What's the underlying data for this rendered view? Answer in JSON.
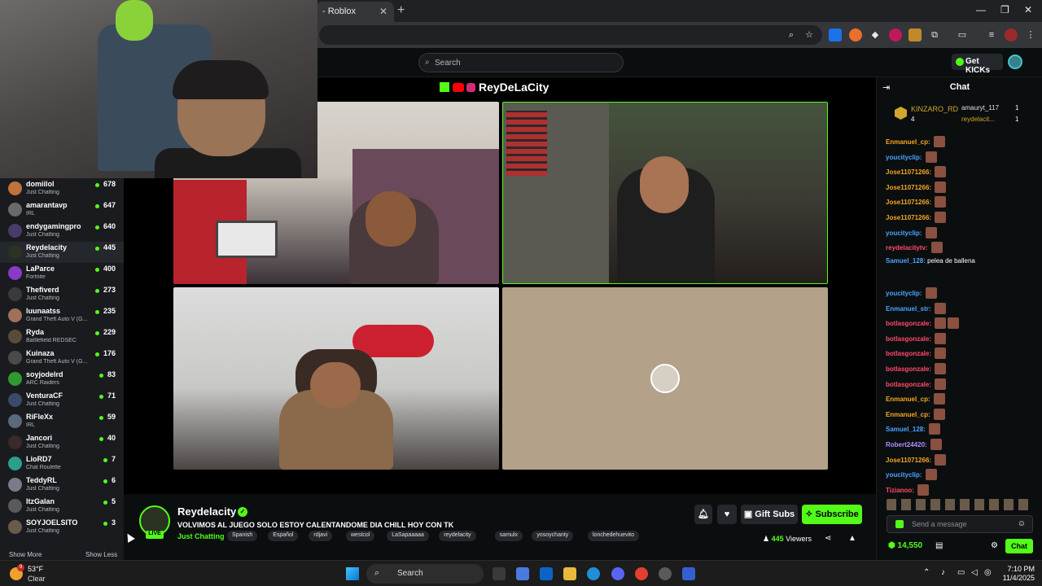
{
  "browser": {
    "tab_title": "- Roblox",
    "tab_close": "✕",
    "new_tab": "+",
    "min": "—",
    "max": "❐",
    "close": "✕"
  },
  "kick": {
    "search_placeholder": "Search",
    "get_kicks": "Get KICKs"
  },
  "sidebar": {
    "channels": [
      {
        "name": "domiilol",
        "category": "Just Chatting",
        "viewers": "678",
        "color": "#c0733a"
      },
      {
        "name": "amarantavp",
        "category": "IRL",
        "viewers": "647",
        "color": "#6a6a6a"
      },
      {
        "name": "endygamingpro",
        "category": "Just Chatting",
        "viewers": "640",
        "color": "#4a3b6a"
      },
      {
        "name": "Reydelacity",
        "category": "Just Chatting",
        "viewers": "445",
        "color": "#2a3322"
      },
      {
        "name": "LaParce",
        "category": "Fortnite",
        "viewers": "400",
        "color": "#8a3ac8"
      },
      {
        "name": "Thefiverd",
        "category": "Just Chatting",
        "viewers": "273",
        "color": "#3a3a3a"
      },
      {
        "name": "luunaatss",
        "category": "Grand Theft Auto V (G...",
        "viewers": "235",
        "color": "#a0705a"
      },
      {
        "name": "Ryda",
        "category": "Battlefield REDSEC",
        "viewers": "229",
        "color": "#5a4a3a"
      },
      {
        "name": "Kuinaza",
        "category": "Grand Theft Auto V (G...",
        "viewers": "176",
        "color": "#4a4a4a"
      },
      {
        "name": "soyjodelrd",
        "category": "ARC Raiders",
        "viewers": "83",
        "color": "#2f9a2f"
      },
      {
        "name": "VenturaCF",
        "category": "Just Chatting",
        "viewers": "71",
        "color": "#3a4a6a"
      },
      {
        "name": "RiFleXx",
        "category": "IRL",
        "viewers": "59",
        "color": "#5a6a7a"
      },
      {
        "name": "Jancori",
        "category": "Just Chatting",
        "viewers": "40",
        "color": "#3a2a2a"
      },
      {
        "name": "LioRD7",
        "category": "Chat Roulette",
        "viewers": "7",
        "color": "#2aa08a"
      },
      {
        "name": "TeddyRL",
        "category": "Just Chatting",
        "viewers": "6",
        "color": "#7a7a8a"
      },
      {
        "name": "ItzGalan",
        "category": "Just Chatting",
        "viewers": "5",
        "color": "#5a5a5a"
      },
      {
        "name": "SOYJOELSITO",
        "category": "Just Chatting",
        "viewers": "3",
        "color": "#6a5a4a"
      }
    ],
    "show_more": "Show More",
    "show_less": "Show Less"
  },
  "player": {
    "banner": "ReyDeLaCity"
  },
  "stream": {
    "live_badge": "LIVE",
    "streamer": "Reydelacity",
    "title": "VOLVIMOS AL JUEGO SOLO ESTOY CALENTANDOME DIA CHILL HOY CON TK",
    "category": "Just Chatting",
    "tags": [
      "Spanish",
      "Español",
      "rdjavi",
      "westcol",
      "LaSapaaaaa",
      "reydelacity",
      "samulx",
      "yosoychanty",
      "lonchedehuevito"
    ],
    "gift_subs": "Gift Subs",
    "subscribe": "Subscribe",
    "viewers": "445",
    "viewers_label": "Viewers"
  },
  "chat": {
    "title": "Chat",
    "pinned": {
      "name": "KINZARO_RD",
      "num": "4",
      "rows": [
        {
          "name": "amauryt_117",
          "count": "1"
        },
        {
          "name": "reydelacit...",
          "count": "1"
        }
      ]
    },
    "messages": [
      {
        "user": "Enmanuel_cp:",
        "text": "",
        "color": "orange",
        "emotes": 1
      },
      {
        "user": "youcityclip:",
        "text": "",
        "color": "blue",
        "emotes": 1
      },
      {
        "user": "Jose11071266:",
        "text": "",
        "color": "orange",
        "emotes": 1
      },
      {
        "user": "Jose11071266:",
        "text": "",
        "color": "orange",
        "emotes": 1
      },
      {
        "user": "Jose11071266:",
        "text": "",
        "color": "orange",
        "emotes": 1
      },
      {
        "user": "Jose11071266:",
        "text": "",
        "color": "orange",
        "emotes": 1
      },
      {
        "user": "youcityclip:",
        "text": "",
        "color": "blue",
        "emotes": 1
      },
      {
        "user": "reydelacitytv:",
        "text": "",
        "color": "red",
        "emotes": 1
      },
      {
        "user": "Samuel_128:",
        "text": "pelea de ballena",
        "color": "blue",
        "emotes": 0
      },
      {
        "user": "",
        "text": "",
        "color": "blue",
        "emotes": 0
      },
      {
        "user": "youcityclip:",
        "text": "",
        "color": "blue",
        "emotes": 1
      },
      {
        "user": "Enmanuel_str:",
        "text": "",
        "color": "blue",
        "emotes": 1
      },
      {
        "user": "botlasgonzale:",
        "text": "",
        "color": "red",
        "emotes": 2
      },
      {
        "user": "botlasgonzale:",
        "text": "",
        "color": "red",
        "emotes": 1
      },
      {
        "user": "botlasgonzale:",
        "text": "",
        "color": "red",
        "emotes": 1
      },
      {
        "user": "botlasgonzale:",
        "text": "",
        "color": "red",
        "emotes": 1
      },
      {
        "user": "botlasgonzale:",
        "text": "",
        "color": "red",
        "emotes": 1
      },
      {
        "user": "Enmanuel_cp:",
        "text": "",
        "color": "orange",
        "emotes": 1
      },
      {
        "user": "Enmanuel_cp:",
        "text": "",
        "color": "orange",
        "emotes": 1
      },
      {
        "user": "Samuel_128:",
        "text": "",
        "color": "blue",
        "emotes": 1
      },
      {
        "user": "Robert24420:",
        "text": "",
        "color": "purple",
        "emotes": 1
      },
      {
        "user": "Jose11071266:",
        "text": "",
        "color": "orange",
        "emotes": 1
      },
      {
        "user": "youcityclip:",
        "text": "",
        "color": "blue",
        "emotes": 1
      },
      {
        "user": "Tizianoo:",
        "text": "",
        "color": "red",
        "emotes": 1
      }
    ],
    "input_placeholder": "Send a message",
    "kicks": "14,550",
    "chat_button": "Chat"
  },
  "taskbar": {
    "temp": "53°F",
    "condition": "Clear",
    "badge": "9",
    "search": "Search",
    "time": "7:10 PM",
    "date": "11/4/2025"
  }
}
